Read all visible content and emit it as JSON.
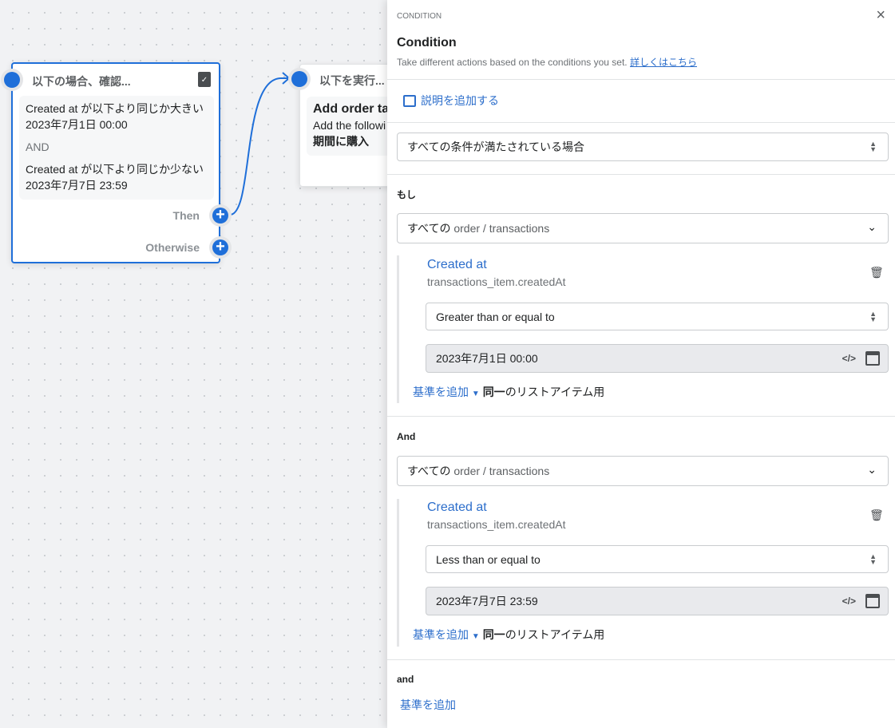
{
  "canvas": {
    "condition_node": {
      "title": "以下の場合、確認...",
      "conditions": [
        {
          "line1": "Created at が以下より同じか大きい",
          "line2": "2023年7月1日 00:00"
        },
        {
          "line1": "Created at が以下より同じか少ない",
          "line2": "2023年7月7日 23:59"
        }
      ],
      "joiner": "AND",
      "then_label": "Then",
      "otherwise_label": "Otherwise"
    },
    "action_node": {
      "title": "以下を実行...",
      "heading": "Add order ta",
      "desc": "Add the followi",
      "tag": "期間に購入"
    }
  },
  "panel": {
    "eyebrow": "CONDITION",
    "title": "Condition",
    "subtitle": "Take different actions based on the conditions you set.",
    "learn_more": "詳しくはこちら",
    "add_description": "説明を追加する",
    "match_select": "すべての条件が満たされている場合",
    "groups": [
      {
        "label": "もし",
        "scope_prefix": "すべての",
        "scope": "order / transactions",
        "field_name": "Created at",
        "field_path": "transactions_item.createdAt",
        "operator": "Greater than or equal to",
        "value": "2023年7月1日 00:00",
        "add_criteria": "基準を追加",
        "same_item_bold": "同一",
        "same_item_rest": "のリストアイテム用"
      },
      {
        "label": "And",
        "scope_prefix": "すべての",
        "scope": "order / transactions",
        "field_name": "Created at",
        "field_path": "transactions_item.createdAt",
        "operator": "Less than or equal to",
        "value": "2023年7月7日 23:59",
        "add_criteria": "基準を追加",
        "same_item_bold": "同一",
        "same_item_rest": "のリストアイテム用"
      }
    ],
    "footer_label": "and",
    "footer_add": "基準を追加"
  },
  "colors": {
    "accent": "#1f6fd9",
    "link": "#2c6ecb"
  }
}
